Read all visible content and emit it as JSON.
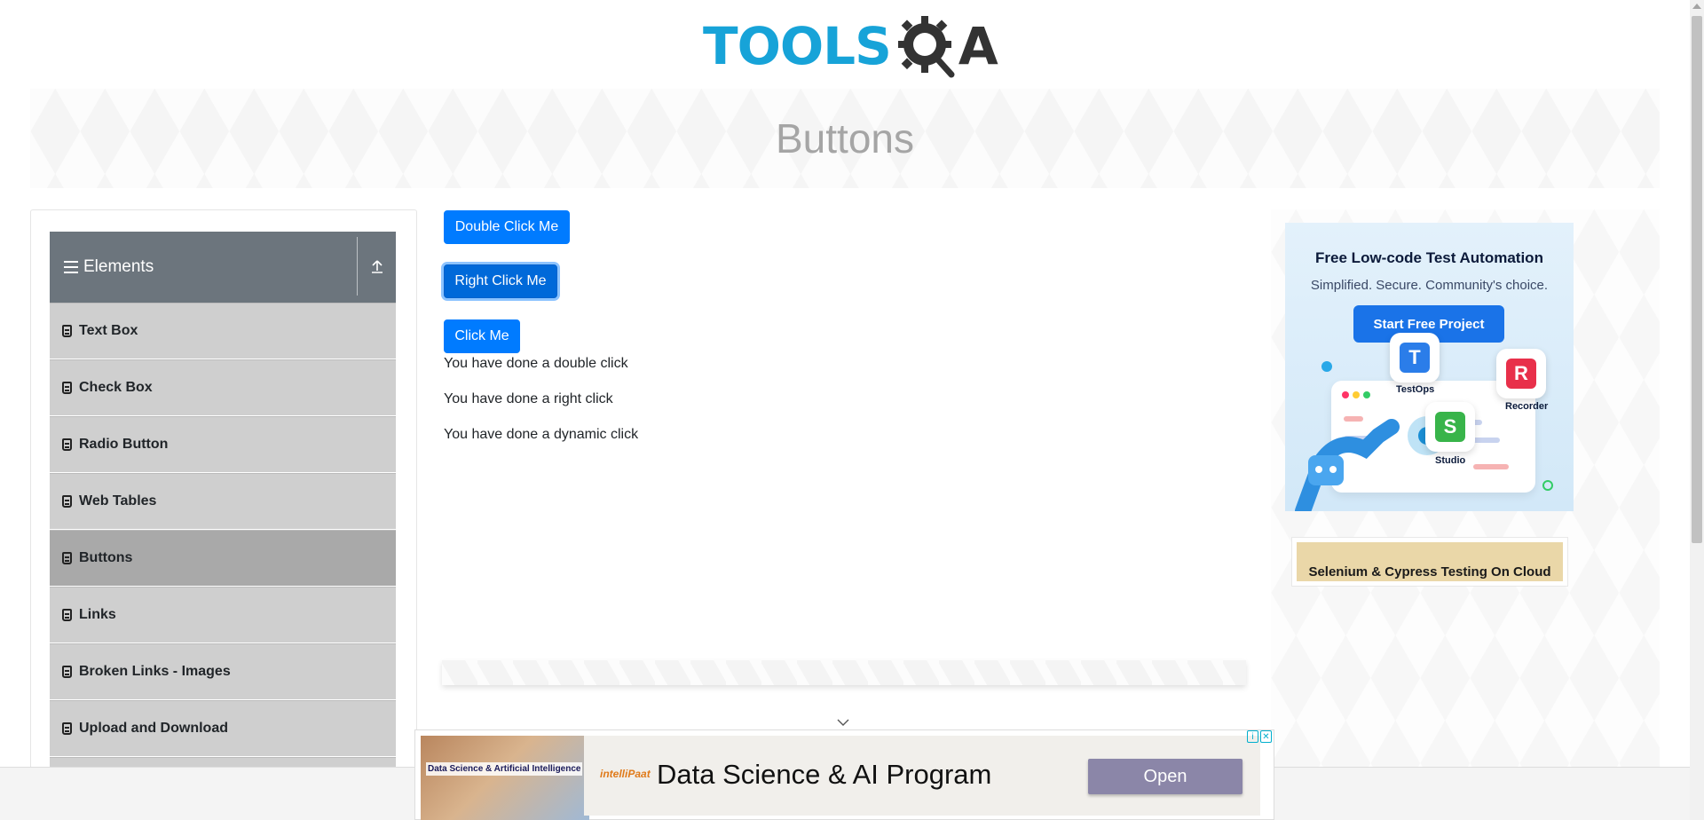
{
  "header": {
    "logo_text": "TOOLS",
    "logo_suffix": "A",
    "page_title": "Buttons"
  },
  "sidebar": {
    "group_title": "Elements",
    "items": [
      {
        "label": "Text Box"
      },
      {
        "label": "Check Box"
      },
      {
        "label": "Radio Button"
      },
      {
        "label": "Web Tables"
      },
      {
        "label": "Buttons",
        "active": true
      },
      {
        "label": "Links"
      },
      {
        "label": "Broken Links - Images"
      },
      {
        "label": "Upload and Download"
      }
    ]
  },
  "main": {
    "double_click_label": "Double Click Me",
    "right_click_label": "Right Click Me",
    "click_label": "Click Me",
    "double_click_message": "You have done a double click",
    "right_click_message": "You have done a right click",
    "dynamic_click_message": "You have done a dynamic click"
  },
  "ads": {
    "katalon": {
      "headline": "Free Low-code Test Automation",
      "subline": "Simplified. Secure. Community's choice.",
      "cta": "Start Free Project",
      "products": [
        "TestOps",
        "Recorder",
        "Studio"
      ]
    },
    "cloud_banner": "Selenium & Cypress Testing On Cloud",
    "bottom": {
      "thumb_text": "Data Science & Artificial Intelligence",
      "brand": "intelliPaat",
      "headline": "Data Science & AI Program",
      "cta": "Open"
    }
  },
  "colors": {
    "primary": "#007bff",
    "sidebar_header": "#6c757d",
    "menu_item": "#cfcfcf",
    "menu_active": "#a9a9a9",
    "logo_blue": "#17a3d8"
  }
}
